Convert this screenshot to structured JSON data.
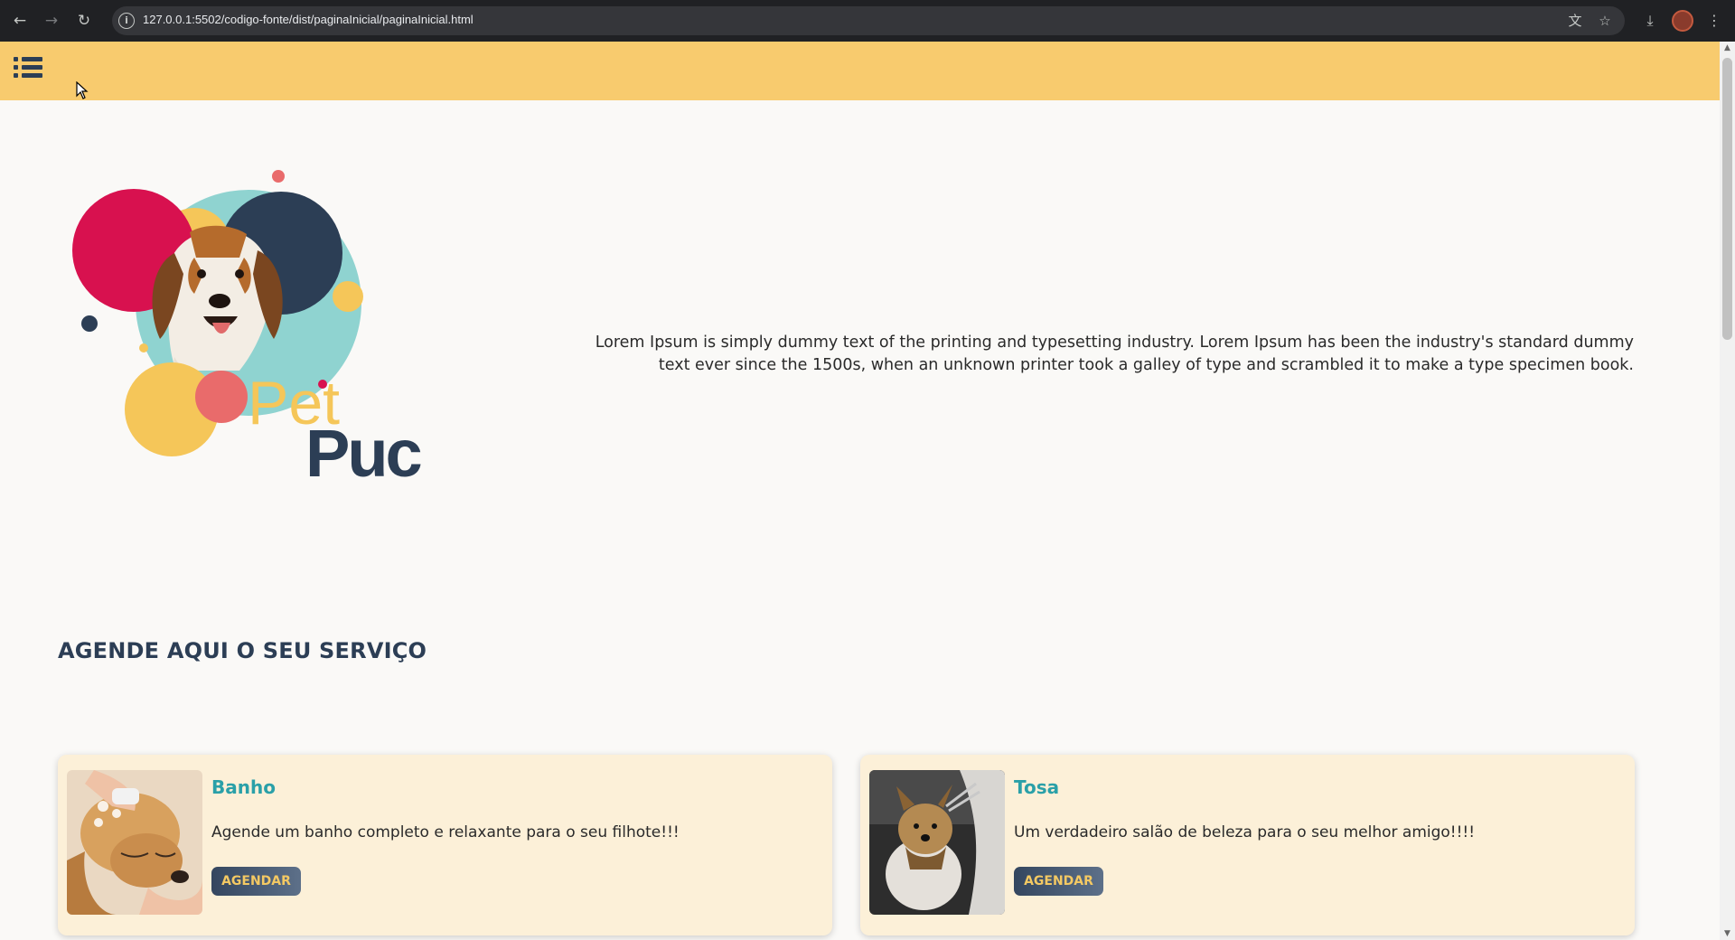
{
  "browser": {
    "url": "127.0.0.1:5502/codigo-fonte/dist/paginaInicial/paginaInicial.html"
  },
  "logo": {
    "word1": "Pet",
    "word2": "Puc"
  },
  "hero": {
    "text": "Lorem Ipsum is simply dummy text of the printing and typesetting industry. Lorem Ipsum has been the industry's standard dummy text ever since the 1500s, when an unknown printer took a galley of type and scrambled it to make a type specimen book."
  },
  "services": {
    "title": "AGENDE AQUI O SEU SERVIÇO",
    "cards": [
      {
        "title": "Banho",
        "description": "Agende um banho completo e relaxante para o seu filhote!!!",
        "button": "AGENDAR"
      },
      {
        "title": "Tosa",
        "description": "Um verdadeiro salão de beleza para o seu melhor amigo!!!!",
        "button": "AGENDAR"
      }
    ]
  },
  "colors": {
    "header_bg": "#f8cb6e",
    "accent_teal": "#2aa0a8",
    "navy": "#2c3e55",
    "logo_yellow": "#f5c659",
    "logo_magenta": "#d8114f",
    "logo_coral": "#e96b6b",
    "logo_mint": "#8fd3d0"
  }
}
